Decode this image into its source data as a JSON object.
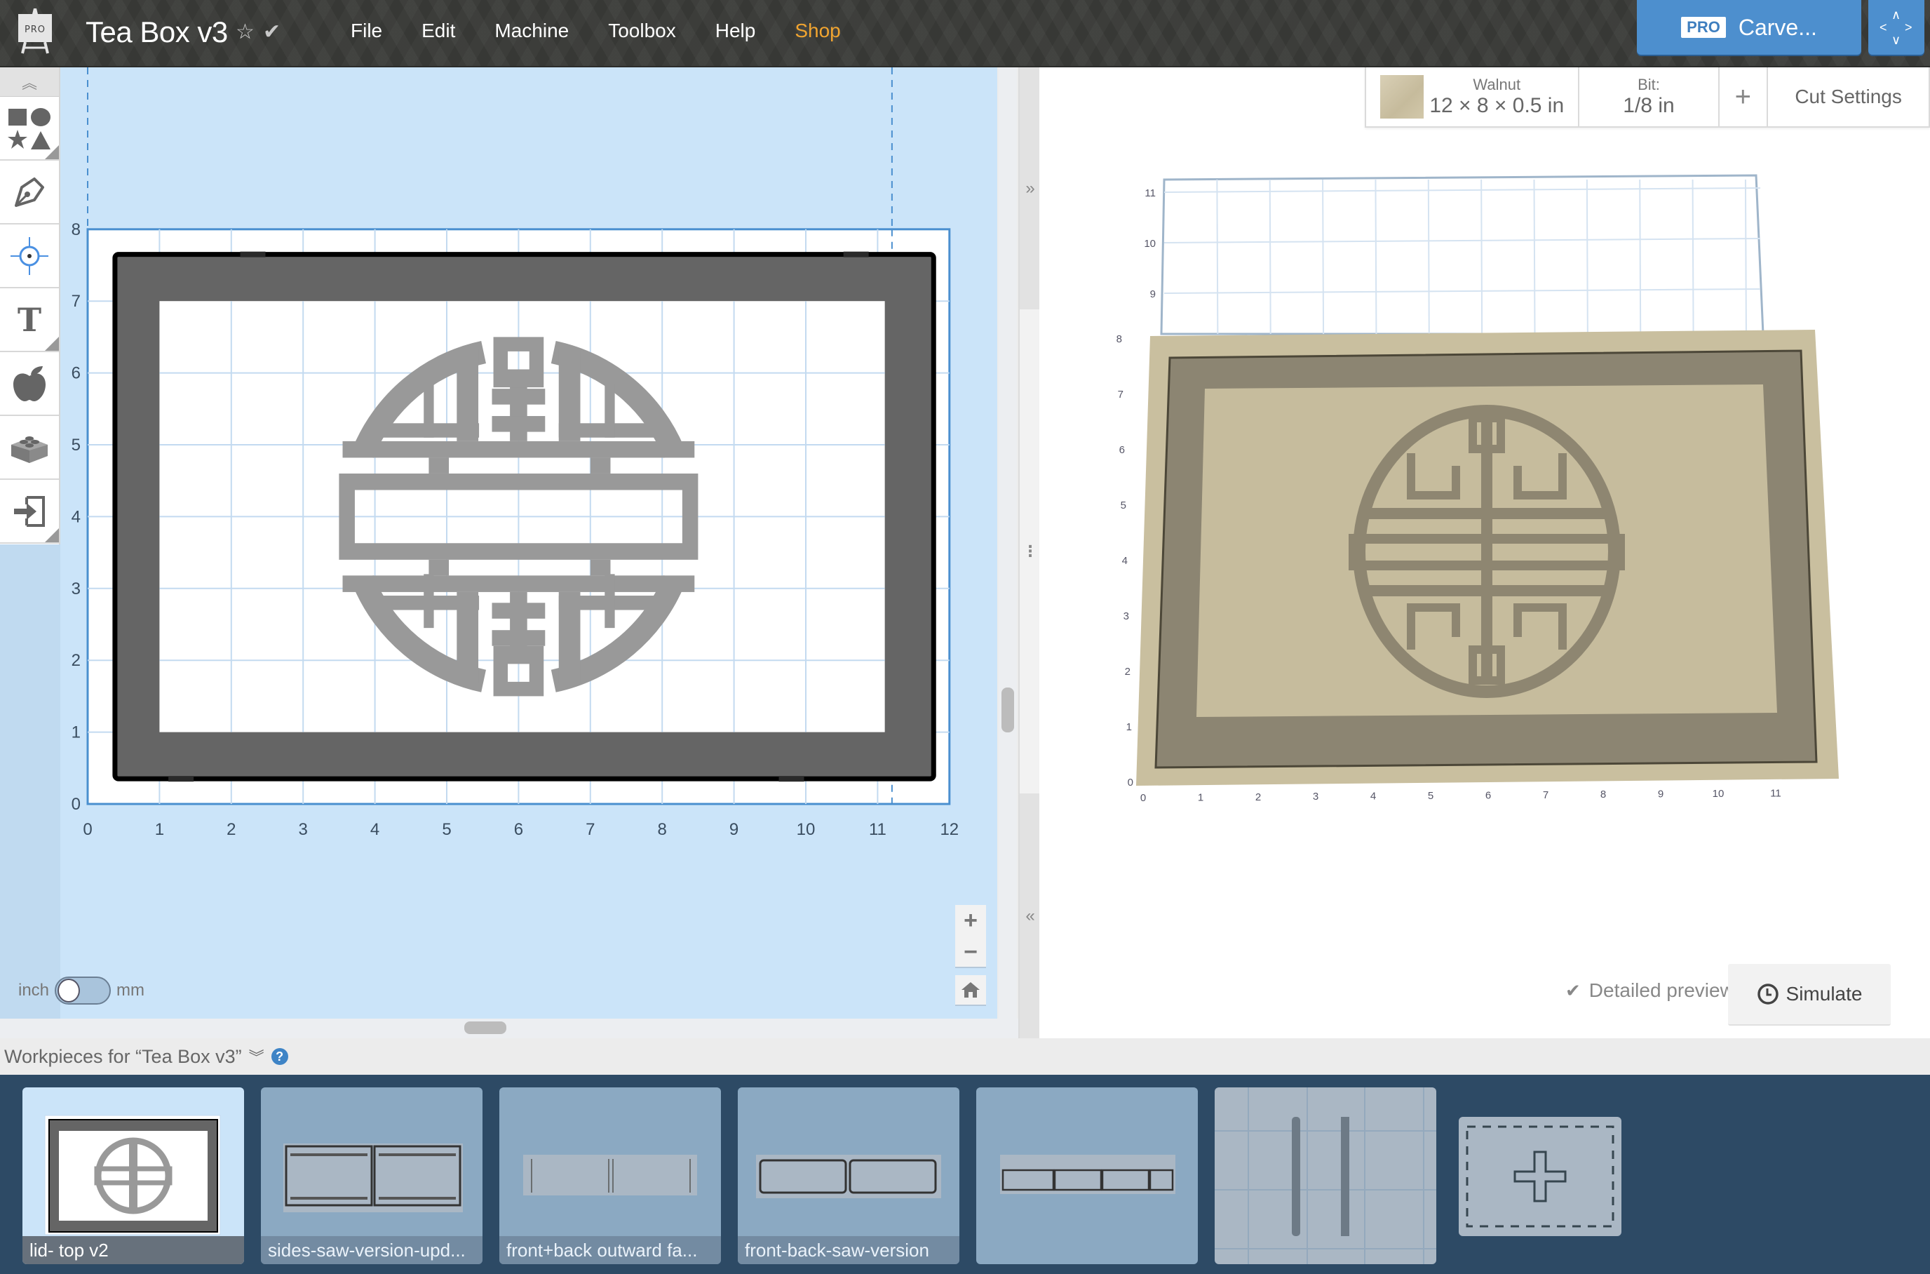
{
  "app": {
    "logo_badge": "PRO",
    "project_title": "Tea Box v3",
    "favorite_icon": "star-outline-icon",
    "saved_icon": "checkmark-icon"
  },
  "menu": [
    {
      "label": "File"
    },
    {
      "label": "Edit"
    },
    {
      "label": "Machine"
    },
    {
      "label": "Toolbox"
    },
    {
      "label": "Help"
    },
    {
      "label": "Shop",
      "color": "#f0a430"
    }
  ],
  "carve_button": {
    "badge": "PRO",
    "label": "Carve..."
  },
  "jog_button": {
    "icon": "jog-arrows-icon",
    "arrows": [
      "∧",
      "<",
      ">",
      "∨"
    ]
  },
  "toolbar": {
    "collapse_icon": "double-chevron-up-icon",
    "tools": [
      {
        "name": "shapes",
        "icon": "shapes-icon"
      },
      {
        "name": "pen",
        "icon": "pen-nib-icon"
      },
      {
        "name": "point",
        "icon": "crosshair-icon"
      },
      {
        "name": "text",
        "icon": "text-icon",
        "glyph": "T"
      },
      {
        "name": "icons",
        "icon": "apple-icon"
      },
      {
        "name": "apps",
        "icon": "lego-brick-icon"
      },
      {
        "name": "import",
        "icon": "import-icon"
      }
    ]
  },
  "canvas": {
    "x_ticks": [
      "0",
      "1",
      "2",
      "3",
      "4",
      "5",
      "6",
      "7",
      "8",
      "9",
      "10",
      "11",
      "12"
    ],
    "y_ticks": [
      "0",
      "1",
      "2",
      "3",
      "4",
      "5",
      "6",
      "7",
      "8"
    ],
    "material_width_in": 12,
    "material_height_in": 8,
    "colors": {
      "background": "#cbe4f9",
      "material": "#ffffff",
      "grid": "#c3daf0",
      "frame": "#656565",
      "symbol": "#999999",
      "outline": "#000000"
    }
  },
  "units": {
    "left": "inch",
    "right": "mm",
    "selected": "inch"
  },
  "zoom_controls": {
    "zoom_in": "+",
    "zoom_out": "−",
    "home_icon": "home-icon"
  },
  "splitter": {
    "expand_right": "»",
    "handle": "⋮",
    "expand_left": "«"
  },
  "material_bar": {
    "material_name": "Walnut",
    "dimensions": "12 × 8 × 0.5 in",
    "bit_label": "Bit:",
    "bit_value": "1/8 in",
    "add_label": "+",
    "cut_settings_label": "Cut Settings"
  },
  "preview": {
    "x_ticks": [
      "0",
      "1",
      "2",
      "3",
      "4",
      "5",
      "6",
      "7",
      "8",
      "9",
      "10",
      "11"
    ],
    "y_ticks": [
      "0",
      "1",
      "2",
      "3",
      "4",
      "5",
      "6",
      "7",
      "8"
    ],
    "back_y_ticks": [
      "9",
      "10",
      "11"
    ],
    "detailed_preview_label": "Detailed preview",
    "simulate_label": "Simulate",
    "wood_color": "#c9bf9f",
    "carved_color": "#8c8572"
  },
  "workpieces": {
    "title": "Workpieces for “Tea Box v3”",
    "help": "?",
    "items": [
      {
        "label": "lid- top v2",
        "active": true
      },
      {
        "label": "sides-saw-version-upd...",
        "active": false
      },
      {
        "label": "front+back outward fa...",
        "active": false
      },
      {
        "label": "front-back-saw-version",
        "active": false
      },
      {
        "label": "",
        "active": false
      },
      {
        "label": "",
        "active": false
      }
    ],
    "add_icon": "add-workpiece-icon"
  }
}
